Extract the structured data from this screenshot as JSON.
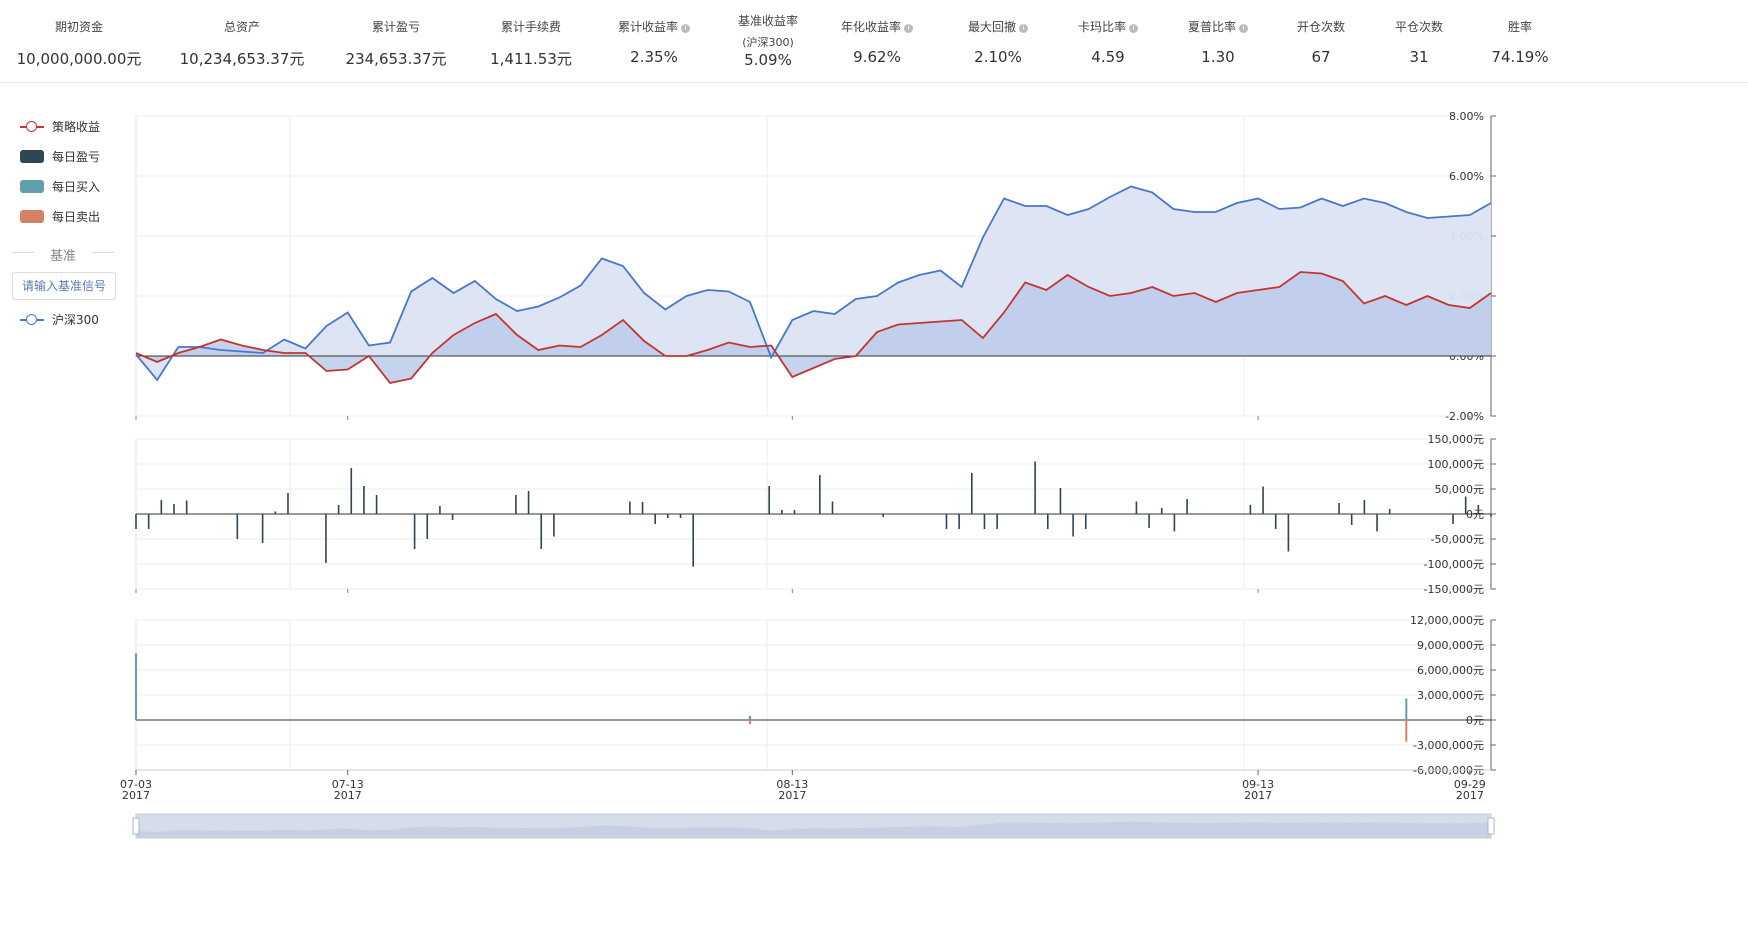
{
  "stats": [
    {
      "label": "期初资金",
      "sub": "",
      "value": "10,000,000.00元",
      "info": false
    },
    {
      "label": "总资产",
      "sub": "",
      "value": "10,234,653.37元",
      "info": false
    },
    {
      "label": "累计盈亏",
      "sub": "",
      "value": "234,653.37元",
      "info": false
    },
    {
      "label": "累计手续费",
      "sub": "",
      "value": "1,411.53元",
      "info": false
    },
    {
      "label": "累计收益率",
      "sub": "",
      "value": "2.35%",
      "info": true
    },
    {
      "label": "基准收益率",
      "sub": "(沪深300)",
      "value": "5.09%",
      "info": false
    },
    {
      "label": "年化收益率",
      "sub": "",
      "value": "9.62%",
      "info": true
    },
    {
      "label": "最大回撤",
      "sub": "",
      "value": "2.10%",
      "info": true
    },
    {
      "label": "卡玛比率",
      "sub": "",
      "value": "4.59",
      "info": true
    },
    {
      "label": "夏普比率",
      "sub": "",
      "value": "1.30",
      "info": true
    },
    {
      "label": "开仓次数",
      "sub": "",
      "value": "67",
      "info": false
    },
    {
      "label": "平仓次数",
      "sub": "",
      "value": "31",
      "info": false
    },
    {
      "label": "胜率",
      "sub": "",
      "value": "74.19%",
      "info": false
    }
  ],
  "legend": {
    "strategy": "策略收益",
    "daily_pnl": "每日盈亏",
    "daily_buy": "每日买入",
    "daily_sell": "每日卖出",
    "benchmark_header": "基准",
    "benchmark_input": "请输入基准信号",
    "benchmark": "沪深300"
  },
  "colors": {
    "strategy": "#c23531",
    "benchmark": "#4878cc",
    "benchmark_fill": "#dbe3f3",
    "strategy_fill": "#bccbea",
    "pnl": "#2f4554",
    "buy": "#61a0a8",
    "sell": "#d48265"
  },
  "chart_data": [
    {
      "type": "line",
      "name": "returns",
      "x_count": 64,
      "y_ticks": [
        "8.00%",
        "6.00%",
        "4.00%",
        "2.00%",
        "0.00%",
        "-2.00%"
      ],
      "ylim": [
        -2,
        8
      ],
      "series": [
        {
          "name": "策略收益",
          "values": [
            0.1,
            -0.2,
            0.1,
            0.3,
            0.55,
            0.35,
            0.2,
            0.1,
            0.1,
            -0.5,
            -0.45,
            0.0,
            -0.9,
            -0.75,
            0.1,
            0.7,
            1.1,
            1.4,
            0.7,
            0.2,
            0.35,
            0.3,
            0.7,
            1.2,
            0.5,
            0.0,
            0.0,
            0.2,
            0.45,
            0.3,
            0.35,
            -0.7,
            -0.4,
            -0.1,
            0.0,
            0.8,
            1.05,
            1.1,
            1.15,
            1.2,
            0.6,
            1.45,
            2.45,
            2.2,
            2.7,
            2.3,
            2.0,
            2.1,
            2.3,
            2.0,
            2.1,
            1.8,
            2.1,
            2.2,
            2.3,
            2.8,
            2.75,
            2.5,
            1.75,
            2.0,
            1.7,
            2.0,
            1.7,
            1.6,
            2.1,
            2.3,
            2.4,
            2.3
          ]
        },
        {
          "name": "沪深300",
          "values": [
            0.05,
            -0.8,
            0.3,
            0.3,
            0.2,
            0.15,
            0.1,
            0.55,
            0.25,
            1.0,
            1.45,
            0.35,
            0.45,
            2.15,
            2.6,
            2.1,
            2.5,
            1.9,
            1.5,
            1.65,
            1.95,
            2.35,
            3.25,
            3.0,
            2.1,
            1.55,
            2.0,
            2.2,
            2.15,
            1.8,
            -0.05,
            1.2,
            1.5,
            1.4,
            1.9,
            2.0,
            2.45,
            2.7,
            2.85,
            2.3,
            3.95,
            5.25,
            5.0,
            5.0,
            4.7,
            4.9,
            5.3,
            5.65,
            5.45,
            4.9,
            4.8,
            4.8,
            5.1,
            5.25,
            4.9,
            4.95,
            5.25,
            5.0,
            5.25,
            5.1,
            4.8,
            4.6,
            4.65,
            4.7,
            5.1
          ]
        }
      ]
    },
    {
      "type": "bar",
      "name": "每日盈亏",
      "y_ticks": [
        "150,000元",
        "100,000元",
        "50,000元",
        "0元",
        "-50,000元",
        "-100,000元",
        "-150,000元"
      ],
      "ylim": [
        -150000,
        150000
      ],
      "values": [
        -30000,
        -30000,
        28000,
        20000,
        27000,
        0,
        0,
        0,
        -50000,
        0,
        -58000,
        5000,
        42000,
        0,
        0,
        -98000,
        18000,
        92000,
        56000,
        38000,
        0,
        0,
        -70000,
        -50000,
        16000,
        -12000,
        0,
        0,
        0,
        0,
        38000,
        46000,
        -70000,
        -45000,
        0,
        0,
        0,
        0,
        0,
        25000,
        24000,
        -20000,
        -8000,
        -8000,
        -105000,
        0,
        0,
        0,
        0,
        0,
        56000,
        8000,
        8000,
        0,
        78000,
        25000,
        0,
        0,
        0,
        -6000,
        0,
        0,
        0,
        0,
        -30000,
        -30000,
        82000,
        -30000,
        -30000,
        0,
        0,
        105000,
        -30000,
        52000,
        -45000,
        -30000,
        0,
        0,
        0,
        25000,
        -28000,
        12000,
        -35000,
        30000,
        0,
        0,
        0,
        0,
        18000,
        55000,
        -30000,
        -75000,
        0,
        0,
        0,
        22000,
        -22000,
        28000,
        -35000,
        10000,
        0,
        0,
        0,
        0,
        -20000,
        35000,
        18000,
        -5000
      ]
    },
    {
      "type": "bar",
      "name": "每日买入/卖出",
      "y_ticks": [
        "12,000,000元",
        "9,000,000元",
        "6,000,000元",
        "3,000,000元",
        "0元",
        "-3,000,000元",
        "-6,000,000元"
      ],
      "ylim": [
        -6000000,
        12000000
      ],
      "series": [
        {
          "name": "每日买入",
          "values": {
            "0": 8000000,
            "29": 500000,
            "60": 2600000
          }
        },
        {
          "name": "每日卖出",
          "values": {
            "29": -500000,
            "60": -2600000
          }
        }
      ]
    }
  ],
  "x_axis": [
    {
      "date": "07-03",
      "year": "2017",
      "idx": 0
    },
    {
      "date": "07-13",
      "year": "2017",
      "idx": 10
    },
    {
      "date": "08-13",
      "year": "2017",
      "idx": 31
    },
    {
      "date": "09-13",
      "year": "2017",
      "idx": 53
    },
    {
      "date": "09-29",
      "year": "2017",
      "idx": 63
    }
  ]
}
